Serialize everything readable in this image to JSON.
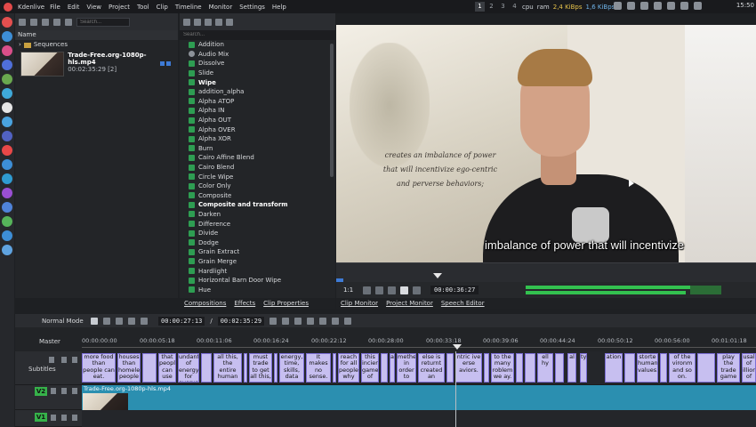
{
  "topbar": {
    "app_name": "Kdenlive",
    "menu": [
      "File",
      "Edit",
      "View",
      "Project",
      "Tool",
      "Clip",
      "Timeline",
      "Monitor",
      "Settings",
      "Help"
    ],
    "workspaces": [
      "1",
      "2",
      "3",
      "4"
    ],
    "cpu_label": "cpu",
    "ram_label": "ram",
    "net_down": "2,4 KiBps",
    "net_up": "1,6 KiBps",
    "clock": "15:50"
  },
  "bin": {
    "search_placeholder": "Search...",
    "column_name": "Name",
    "folder": "Sequences",
    "clip_name": "Trade-Free.org-1080p-hls.mp4",
    "clip_duration": "00:02:35:29 [2]"
  },
  "effects": {
    "search_placeholder": "Search...",
    "items": [
      {
        "label": "Addition",
        "icon": "green",
        "bold": false
      },
      {
        "label": "Audio Mix",
        "icon": "gray",
        "bold": false
      },
      {
        "label": "Dissolve",
        "icon": "green",
        "bold": false
      },
      {
        "label": "Slide",
        "icon": "green",
        "bold": false
      },
      {
        "label": "Wipe",
        "icon": "green",
        "bold": true
      },
      {
        "label": "addition_alpha",
        "icon": "green",
        "bold": false
      },
      {
        "label": "Alpha ATOP",
        "icon": "green",
        "bold": false
      },
      {
        "label": "Alpha IN",
        "icon": "green",
        "bold": false
      },
      {
        "label": "Alpha OUT",
        "icon": "green",
        "bold": false
      },
      {
        "label": "Alpha OVER",
        "icon": "green",
        "bold": false
      },
      {
        "label": "Alpha XOR",
        "icon": "green",
        "bold": false
      },
      {
        "label": "Burn",
        "icon": "green",
        "bold": false
      },
      {
        "label": "Cairo Affine Blend",
        "icon": "green",
        "bold": false
      },
      {
        "label": "Cairo Blend",
        "icon": "green",
        "bold": false
      },
      {
        "label": "Circle Wipe",
        "icon": "green",
        "bold": false
      },
      {
        "label": "Color Only",
        "icon": "green",
        "bold": false
      },
      {
        "label": "Composite",
        "icon": "green",
        "bold": false
      },
      {
        "label": "Composite and transform",
        "icon": "green",
        "bold": true
      },
      {
        "label": "Darken",
        "icon": "green",
        "bold": false
      },
      {
        "label": "Difference",
        "icon": "green",
        "bold": false
      },
      {
        "label": "Divide",
        "icon": "green",
        "bold": false
      },
      {
        "label": "Dodge",
        "icon": "green",
        "bold": false
      },
      {
        "label": "Grain Extract",
        "icon": "green",
        "bold": false
      },
      {
        "label": "Grain Merge",
        "icon": "green",
        "bold": false
      },
      {
        "label": "Hardlight",
        "icon": "green",
        "bold": false
      },
      {
        "label": "Horizontal Barn Door Wipe",
        "icon": "green",
        "bold": false
      },
      {
        "label": "Hue",
        "icon": "green",
        "bold": false
      }
    ]
  },
  "left_tabs": [
    "Compositions",
    "Effects",
    "Clip Properties"
  ],
  "right_tabs": [
    "Clip Monitor",
    "Project Monitor",
    "Speech Editor"
  ],
  "monitor": {
    "quote_lines": [
      "creates an imbalance of power",
      "that will incentivize ego-centric",
      "and perverse behaviors;"
    ],
    "subtitle": "imbalance of power that will incentivize",
    "zoom": "1:1",
    "timecode": "00:00:36:27"
  },
  "timeline": {
    "mode": "Normal Mode",
    "position": "00:00:27:13",
    "duration": "00:02:35:29",
    "master_label": "Master",
    "ticks": [
      "00:00:00:00",
      "00:00:05:18",
      "00:00:11:06",
      "00:00:16:24",
      "00:00:22:12",
      "00:00:28:00",
      "00:00:33:18",
      "00:00:39:06",
      "00:00:44:24",
      "00:00:50:12",
      "00:00:56:00",
      "00:01:01:18"
    ],
    "subtitles_label": "Subtitles",
    "v2_label": "V2",
    "v1_label": "V1",
    "clip_name": "Trade-Free.org-1080p-hls.mp4",
    "subs": [
      {
        "text": "more food than people can eat.",
        "l": 0,
        "w": 38
      },
      {
        "text": "houses than homeless people",
        "l": 40,
        "w": 26
      },
      {
        "text": "",
        "l": 68,
        "w": 16
      },
      {
        "text": "that people can use",
        "l": 86,
        "w": 20
      },
      {
        "text": "undant of energy for everyone",
        "l": 108,
        "w": 24
      },
      {
        "text": "",
        "l": 134,
        "w": 12
      },
      {
        "text": "all this, the entire human",
        "l": 148,
        "w": 32
      },
      {
        "text": "",
        "l": 182,
        "w": 4
      },
      {
        "text": "must trade to get all this,",
        "l": 188,
        "w": 26
      },
      {
        "text": "",
        "l": 216,
        "w": 4
      },
      {
        "text": "energy, time, skills, data",
        "l": 222,
        "w": 28
      },
      {
        "text": "It makes no sense.",
        "l": 252,
        "w": 28
      },
      {
        "text": "",
        "l": 282,
        "w": 4
      },
      {
        "text": "reach for all people why",
        "l": 288,
        "w": 24
      },
      {
        "text": "this inciency game of",
        "l": 314,
        "w": 20
      },
      {
        "text": "",
        "l": 336,
        "w": 8
      },
      {
        "text": "a",
        "l": 346,
        "w": 6
      },
      {
        "text": "methe in order to",
        "l": 354,
        "w": 22
      },
      {
        "text": "else is returnt created an",
        "l": 378,
        "w": 30
      },
      {
        "text": "",
        "l": 410,
        "w": 8
      },
      {
        "text": "ntric ive erse aviors.",
        "l": 420,
        "w": 30
      },
      {
        "text": "",
        "l": 452,
        "w": 6
      },
      {
        "text": "to the many roblem we ay.",
        "l": 460,
        "w": 26
      },
      {
        "text": "",
        "l": 488,
        "w": 8
      },
      {
        "text": "",
        "l": 498,
        "w": 12
      },
      {
        "text": "ell hy",
        "l": 512,
        "w": 18
      },
      {
        "text": "",
        "l": 532,
        "w": 10
      },
      {
        "text": "al",
        "l": 546,
        "w": 10
      },
      {
        "text": "ty.",
        "l": 560,
        "w": 8
      },
      {
        "text": "ation",
        "l": 588,
        "w": 20
      },
      {
        "text": "",
        "l": 610,
        "w": 12
      },
      {
        "text": "storte human values.",
        "l": 624,
        "w": 24
      },
      {
        "text": "",
        "l": 650,
        "w": 8
      },
      {
        "text": "of the vironm and so on.",
        "l": 660,
        "w": 30
      },
      {
        "text": "",
        "l": 692,
        "w": 20
      },
      {
        "text": "play the trade game",
        "l": 714,
        "w": 26
      },
      {
        "text": "usal of illion of",
        "l": 742,
        "w": 16
      }
    ]
  }
}
